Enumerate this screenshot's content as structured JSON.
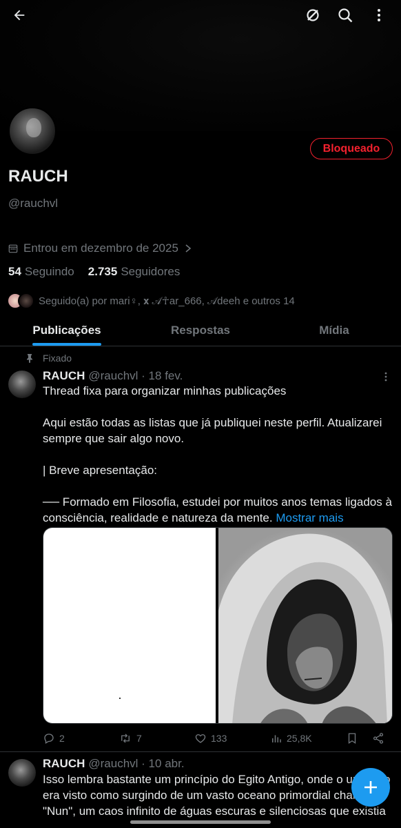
{
  "profile": {
    "name": "RAUCH",
    "handle": "@rauchvl",
    "blocked_label": "Bloqueado",
    "joined": "Entrou em dezembro de 2025",
    "following_count": "54",
    "following_label": "Seguindo",
    "followers_count": "2.735",
    "followers_label": "Seguidores",
    "followed_by": "Seguido(a) por mari♀, 𝐱 𝒜☥ar_666, 𝒜deeh e outros 14"
  },
  "tabs": [
    "Publicações",
    "Respostas",
    "Mídia"
  ],
  "pinned_label": "Fixado",
  "posts": [
    {
      "name": "RAUCH",
      "meta": "@rauchvl · 18 fev.",
      "paragraphs": [
        "Thread fixa para organizar minhas publicações",
        "Aqui estão todas as listas que já publiquei neste perfil. Atualizarei sempre que sair algo novo.",
        "| Breve apresentação:",
        "── Formado em Filosofia, estudei por muitos anos temas ligados à consciência, realidade e natureza da mente."
      ],
      "show_more": "Mostrar mais",
      "replies": "2",
      "reposts": "7",
      "likes": "133",
      "views": "25,8K"
    },
    {
      "name": "RAUCH",
      "meta": "@rauchvl · 10 abr.",
      "text": "Isso lembra bastante um princípio do Egito Antigo, onde o universo era visto como surgindo de um vasto oceano primordial chamado \"Nun\", um caos infinito de águas escuras e silenciosas que existia"
    }
  ],
  "colors": {
    "background": "#000000",
    "accent": "#1d9bf0",
    "blocked": "#f4212e",
    "muted": "#71767b",
    "text": "#e7e9ea"
  }
}
